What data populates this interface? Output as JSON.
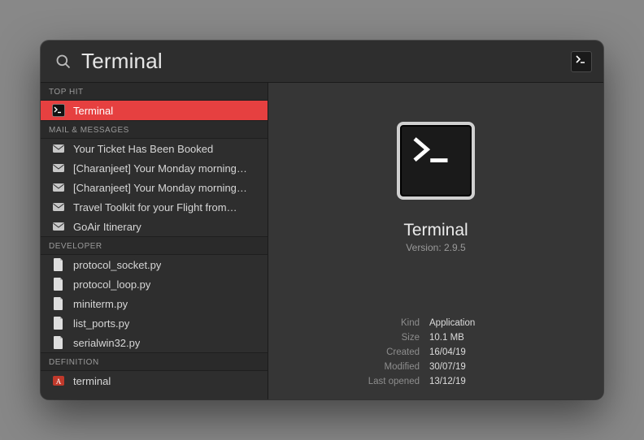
{
  "search": {
    "query": "Terminal"
  },
  "categories": {
    "top_hit": "TOP HIT",
    "mail": "MAIL & MESSAGES",
    "developer": "DEVELOPER",
    "definition": "DEFINITION"
  },
  "results": {
    "top_hit": [
      {
        "icon": "terminal",
        "label": "Terminal",
        "selected": true
      }
    ],
    "mail": [
      {
        "icon": "mail",
        "label": "Your Ticket Has Been Booked"
      },
      {
        "icon": "mail",
        "label": "[Charanjeet] Your Monday morning…"
      },
      {
        "icon": "mail",
        "label": "[Charanjeet] Your Monday morning…"
      },
      {
        "icon": "mail",
        "label": "Travel Toolkit for your Flight from…"
      },
      {
        "icon": "mail",
        "label": "GoAir Itinerary"
      }
    ],
    "developer": [
      {
        "icon": "doc",
        "label": "protocol_socket.py"
      },
      {
        "icon": "doc",
        "label": "protocol_loop.py"
      },
      {
        "icon": "doc",
        "label": "miniterm.py"
      },
      {
        "icon": "doc",
        "label": "list_ports.py"
      },
      {
        "icon": "doc",
        "label": "serialwin32.py"
      }
    ],
    "definition": [
      {
        "icon": "dict",
        "label": "terminal"
      }
    ]
  },
  "preview": {
    "title": "Terminal",
    "subtitle": "Version: 2.9.5",
    "meta": [
      {
        "key": "Kind",
        "value": "Application"
      },
      {
        "key": "Size",
        "value": "10.1 MB"
      },
      {
        "key": "Created",
        "value": "16/04/19"
      },
      {
        "key": "Modified",
        "value": "30/07/19"
      },
      {
        "key": "Last opened",
        "value": "13/12/19"
      }
    ]
  }
}
